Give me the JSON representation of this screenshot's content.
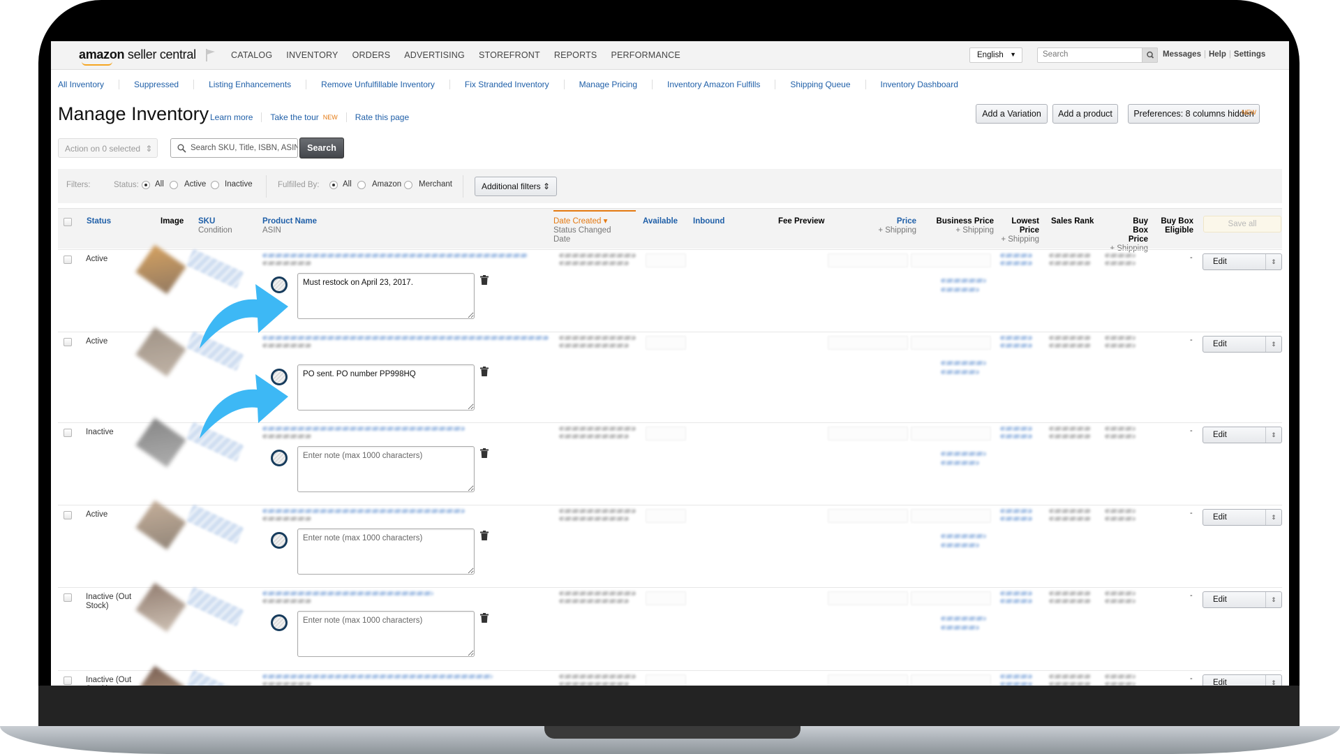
{
  "app": {
    "logo_brand": "amazon",
    "logo_product": "seller central"
  },
  "topnav": {
    "menu": [
      "CATALOG",
      "INVENTORY",
      "ORDERS",
      "ADVERTISING",
      "STOREFRONT",
      "REPORTS",
      "PERFORMANCE"
    ],
    "language": "English",
    "search_placeholder": "Search",
    "links": [
      "Messages",
      "Help",
      "Settings"
    ]
  },
  "subnav": [
    "All Inventory",
    "Suppressed",
    "Listing Enhancements",
    "Remove Unfulfillable Inventory",
    "Fix Stranded Inventory",
    "Manage Pricing",
    "Inventory Amazon Fulfills",
    "Shipping Queue",
    "Inventory Dashboard"
  ],
  "page": {
    "title": "Manage Inventory",
    "learn_more": "Learn more",
    "take_tour": "Take the tour",
    "new_badge": "NEW",
    "rate_page": "Rate this page",
    "add_variation": "Add a Variation",
    "add_product": "Add a product",
    "preferences": "Preferences: 8 columns hidden"
  },
  "actions": {
    "bulk_action": "Action on 0 selected",
    "search_placeholder": "Search SKU, Title, ISBN, ASIN",
    "search_button": "Search"
  },
  "filters": {
    "label": "Filters:",
    "status_label": "Status:",
    "status_options": [
      "All",
      "Active",
      "Inactive"
    ],
    "status_selected": "All",
    "fulfilled_label": "Fulfilled By:",
    "fulfilled_options": [
      "All",
      "Amazon",
      "Merchant"
    ],
    "fulfilled_selected": "All",
    "additional": "Additional filters"
  },
  "table": {
    "columns": {
      "status": "Status",
      "image": "Image",
      "sku": "SKU",
      "sku_sub": "Condition",
      "product_name": "Product Name",
      "product_sub": "ASIN",
      "date_created": "Date Created",
      "date_sub": "Status Changed Date",
      "available": "Available",
      "inbound": "Inbound",
      "fee_preview": "Fee Preview",
      "price": "Price",
      "price_sub": "+ Shipping",
      "business_price": "Business Price",
      "business_sub": "+ Shipping",
      "lowest_price": "Lowest Price",
      "lowest_sub": "+ Shipping",
      "sales_rank": "Sales Rank",
      "buybox_price": "Buy Box Price",
      "buybox_sub": "+ Shipping",
      "buybox_eligible": "Buy Box Eligible",
      "save_all": "Save all"
    },
    "rows": [
      {
        "status": "Active",
        "note": "Must restock on April 23, 2017.",
        "buybox_eligible": "-",
        "action": "Edit"
      },
      {
        "status": "Active",
        "note": "PO sent. PO number PP998HQ",
        "buybox_eligible": "-",
        "action": "Edit"
      },
      {
        "status": "Inactive",
        "note": "",
        "buybox_eligible": "-",
        "action": "Edit"
      },
      {
        "status": "Active",
        "note": "",
        "buybox_eligible": "-",
        "action": "Edit"
      },
      {
        "status": "Inactive (Out Stock)",
        "note": "",
        "buybox_eligible": "-",
        "action": "Edit"
      },
      {
        "status": "Inactive (Out Stock)",
        "note": "",
        "buybox_eligible": "-",
        "action": "Edit"
      }
    ],
    "note_placeholder": "Enter note (max 1000 characters)"
  },
  "colors": {
    "link": "#1f5fa8",
    "accent_orange": "#e47911",
    "arrow_blue": "#3db8f5",
    "note_circle": "#163b5c"
  }
}
